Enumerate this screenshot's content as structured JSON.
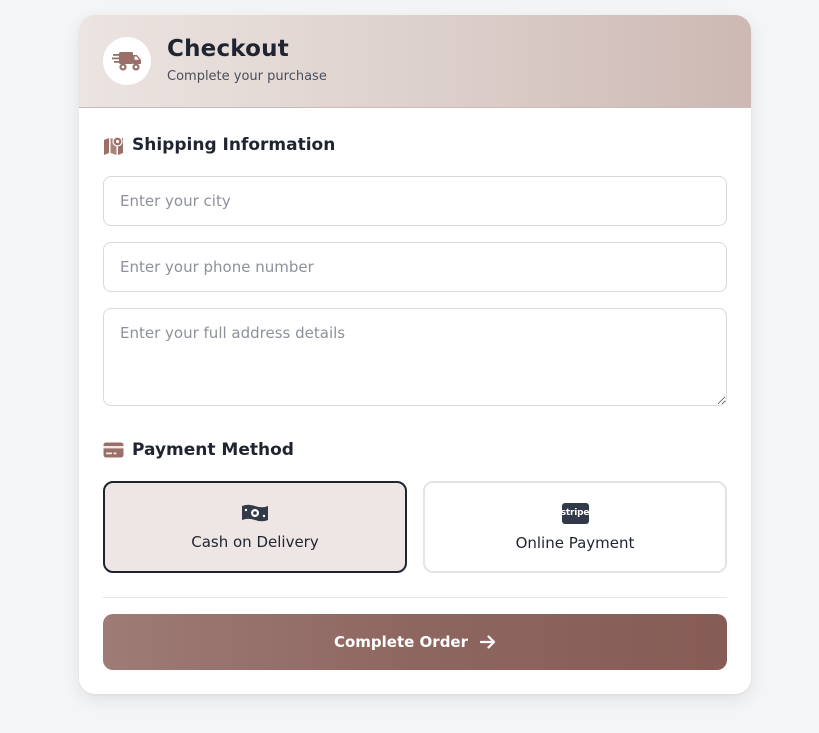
{
  "header": {
    "icon": "truck-icon",
    "title": "Checkout",
    "subtitle": "Complete your purchase"
  },
  "shipping": {
    "icon": "map-icon",
    "title": "Shipping Information",
    "city_placeholder": "Enter your city",
    "phone_placeholder": "Enter your phone number",
    "address_placeholder": "Enter your full address details"
  },
  "payment": {
    "icon": "credit-card-icon",
    "title": "Payment Method",
    "options": [
      {
        "label": "Cash on Delivery",
        "icon": "money-bill-icon",
        "selected": true
      },
      {
        "label": "Online Payment",
        "icon": "stripe-icon",
        "icon_text": "stripe",
        "selected": false
      }
    ]
  },
  "submit": {
    "label": "Complete Order",
    "icon": "arrow-right-icon"
  },
  "colors": {
    "accent": "#8e6660",
    "icon_brown": "#9a6f68",
    "selected_bg": "#ede6e4",
    "text_dark": "#1f2430"
  }
}
